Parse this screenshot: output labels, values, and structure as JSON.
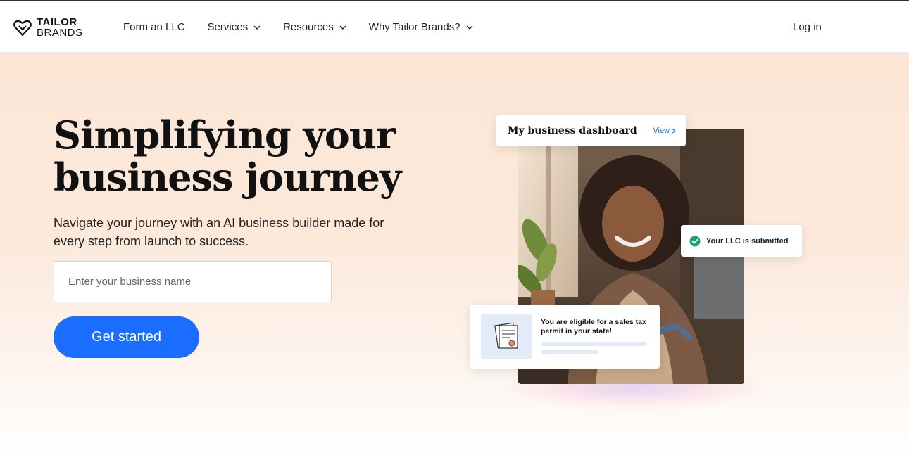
{
  "brand": {
    "logo_line1": "TAILOR",
    "logo_line2": "BRANDS"
  },
  "nav": {
    "items": [
      {
        "label": "Form an LLC",
        "has_dropdown": false
      },
      {
        "label": "Services",
        "has_dropdown": true
      },
      {
        "label": "Resources",
        "has_dropdown": true
      },
      {
        "label": "Why Tailor Brands?",
        "has_dropdown": true
      }
    ],
    "login": "Log in"
  },
  "hero": {
    "title_line1": "Simplifying your",
    "title_line2": "business journey",
    "subtitle": "Navigate your journey with an AI business builder made for every step from launch to success.",
    "input_placeholder": "Enter your business name",
    "cta": "Get started"
  },
  "visual": {
    "dashboard_title": "My business dashboard",
    "dashboard_view": "View",
    "llc_status": "Your LLC is submitted",
    "tax_message": "You are eligible for a sales tax permit in your state!"
  },
  "colors": {
    "accent": "#1a6dff",
    "hero_bg": "#fbe6d6",
    "success": "#22a06b"
  }
}
